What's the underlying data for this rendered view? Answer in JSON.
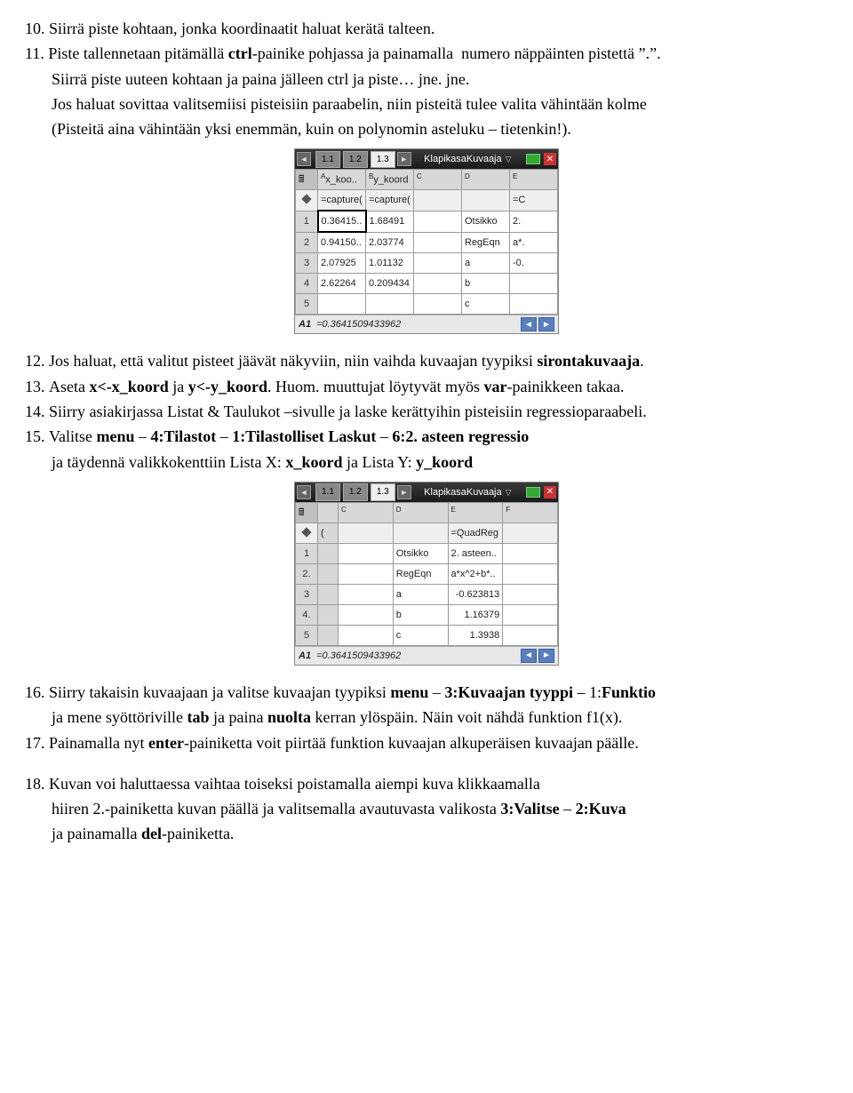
{
  "p10": "10. Siirrä piste kohtaan, jonka koordinaatit haluat kerätä talteen.",
  "p11a": "11. Piste tallennetaan pitämällä ",
  "p11b": "ctrl",
  "p11c": "-painike pohjassa ja painamalla  numero näppäinten pistettä ”.”.",
  "p11d": "Siirrä piste uuteen kohtaan ja paina jälleen ctrl ja piste… jne. jne.",
  "p11e": "Jos haluat sovittaa valitsemiisi pisteisiin paraabelin, niin pisteitä tulee valita vähintään kolme",
  "p11f": "(Pisteitä aina vähintään yksi enemmän, kuin on polynomin asteluku – tietenkin!).",
  "p12a": "12. Jos haluat, että valitut pisteet jäävät näkyviin, niin vaihda kuvaajan tyypiksi ",
  "p12b": "sirontakuvaaja",
  "p12c": ".",
  "p13a": "13. Aseta ",
  "p13b": "x<-x_koord",
  "p13c": " ja ",
  "p13d": "y<-y_koord",
  "p13e": ". Huom. muuttujat löytyvät myös ",
  "p13f": "var",
  "p13g": "-painikkeen takaa.",
  "p14": "14. Siirry asiakirjassa Listat & Taulukot –sivulle ja laske kerättyihin pisteisiin regressioparaabeli.",
  "p15a": "15. Valitse ",
  "p15b": "menu",
  "p15c": " – ",
  "p15d": "4:Tilastot",
  "p15e": " – ",
  "p15f": "1:Tilastolliset Laskut",
  "p15g": " – ",
  "p15h": "6:2. asteen regressio",
  "p15i": "ja täydennä valikkokenttiin Lista X: ",
  "p15j": "x_koord",
  "p15k": " ja Lista Y: ",
  "p15l": "y_koord",
  "p16a": "16. Siirry takaisin kuvaajaan ja valitse kuvaajan tyypiksi ",
  "p16b": "menu",
  "p16c": " – ",
  "p16d": "3:Kuvaajan tyyppi",
  "p16e": " – 1:",
  "p16f": "Funktio",
  "p16g": "ja mene syöttöriville ",
  "p16h": "tab",
  "p16i": " ja paina ",
  "p16j": "nuolta",
  "p16k": " kerran ylöspäin. Näin voit nähdä funktion f1(x).",
  "p17a": "17. Painamalla nyt ",
  "p17b": "enter",
  "p17c": "-painiketta voit piirtää funktion kuvaajan alkuperäisen kuvaajan päälle.",
  "p18a": "18. Kuvan voi haluttaessa vaihtaa toiseksi poistamalla aiempi kuva klikkaamalla",
  "p18b": "hiiren 2.-painiketta kuvan päällä ja valitsemalla avautuvasta valikosta ",
  "p18c": "3:Valitse",
  "p18d": " – ",
  "p18e": "2:Kuva",
  "p18f": "ja painamalla ",
  "p18g": "del",
  "p18h": "-painiketta.",
  "calc1": {
    "title": "KlapikasaKuvaaja",
    "tabs": [
      "1.1",
      "1.2",
      "1.3"
    ],
    "colLetters": [
      "A",
      "B",
      "C",
      "D",
      "E"
    ],
    "colNames": [
      "x_koo..",
      "y_koord",
      "",
      "",
      ""
    ],
    "formulas": [
      "=capture(",
      "=capture(",
      "",
      "",
      "=C"
    ],
    "rows": [
      [
        "0.36415..",
        "1.68491",
        "",
        "Otsikko",
        "2."
      ],
      [
        "0.94150..",
        "2.03774",
        "",
        "RegEqn",
        "a*."
      ],
      [
        "2.07925",
        "1.01132",
        "",
        "a",
        "-0."
      ],
      [
        "2.62264",
        "0.209434",
        "",
        "b",
        ""
      ],
      [
        "",
        "",
        "",
        "c",
        ""
      ]
    ],
    "statusCell": "A1",
    "statusVal": "=0.3641509433962"
  },
  "calc2": {
    "title": "KlapikasaKuvaaja",
    "tabs": [
      "1.1",
      "1.2",
      "1.3"
    ],
    "colLetters": [
      "C",
      "D",
      "E",
      "F"
    ],
    "formulas": [
      "",
      "",
      "=QuadReg",
      ""
    ],
    "rows": [
      [
        "",
        "Otsikko",
        "2. asteen..",
        ""
      ],
      [
        "",
        "RegEqn",
        "a*x^2+b*..",
        ""
      ],
      [
        "",
        "a",
        "-0.623813",
        ""
      ],
      [
        "",
        "b",
        "1.16379",
        ""
      ],
      [
        "",
        "c",
        "1.3938",
        ""
      ]
    ],
    "statusCell": "A1",
    "statusVal": "=0.3641509433962"
  }
}
